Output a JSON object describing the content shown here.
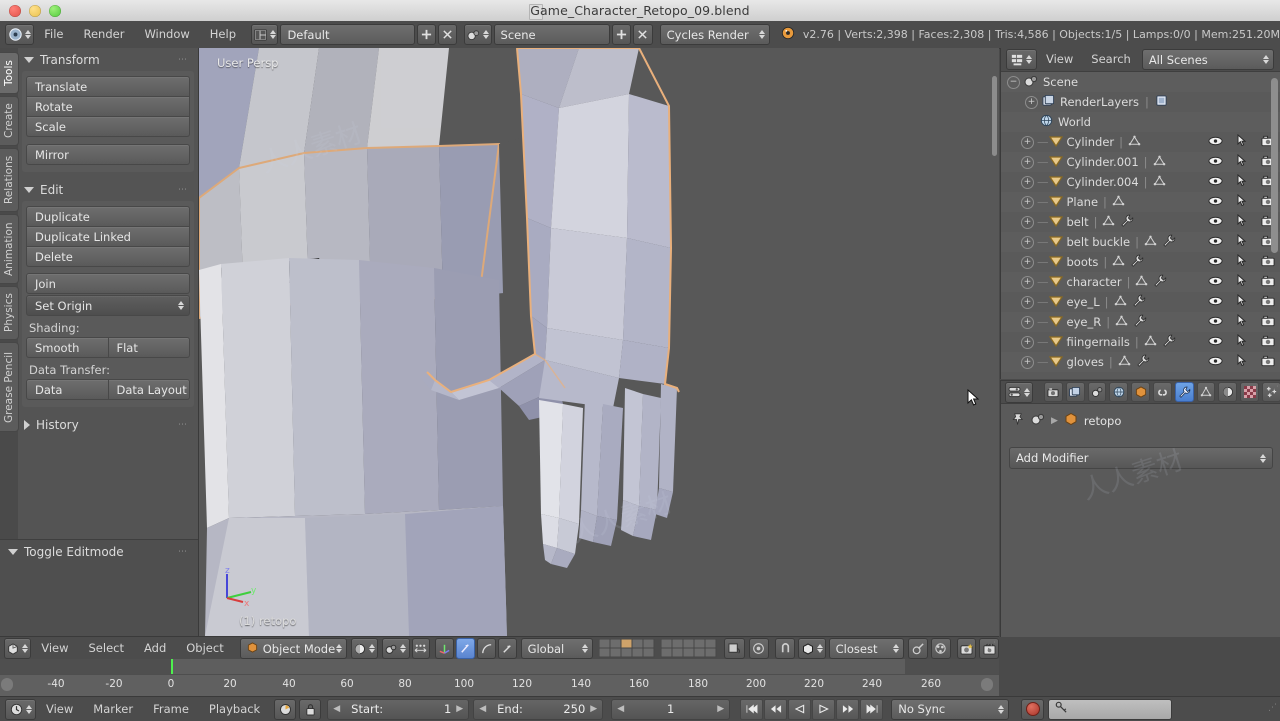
{
  "window": {
    "title": "Game_Character_Retopo_09.blend",
    "traffic_lights": [
      "close-red",
      "minimize-yellow",
      "maximize-green"
    ]
  },
  "topbar": {
    "blender_icon": "blender-logo-icon",
    "menus": [
      "File",
      "Render",
      "Window",
      "Help"
    ],
    "screen_layout_icon": "screen-layout-icon",
    "screen_layout": "Default",
    "add_layout_icon": "plus-icon",
    "delete_layout_icon": "x-cross-icon",
    "scene_icon": "scene-icon",
    "scene": "Scene",
    "add_scene_icon": "plus-icon",
    "delete_scene_icon": "x-cross-icon",
    "render_engine": "Cycles Render",
    "render_engine_icon": "render-engine-icon",
    "stats": "v2.76 | Verts:2,398 | Faces:2,308 | Tris:4,586 | Objects:1/5 | Lamps:0/0 | Mem:251.20M"
  },
  "toolshelf": {
    "tabs": [
      {
        "label": "Tools",
        "active": true
      },
      {
        "label": "Create",
        "active": false
      },
      {
        "label": "Relations",
        "active": false
      },
      {
        "label": "Animation",
        "active": false
      },
      {
        "label": "Physics",
        "active": false
      },
      {
        "label": "Grease Pencil",
        "active": false
      }
    ],
    "panels": [
      {
        "title": "Transform",
        "open": true,
        "buttons": [
          "Translate",
          "Rotate",
          "Scale",
          "Mirror"
        ]
      },
      {
        "title": "Edit",
        "open": true,
        "buttons": [
          "Duplicate",
          "Duplicate Linked",
          "Delete",
          "Join"
        ],
        "dropdown": "Set Origin",
        "shading_label": "Shading:",
        "shading": [
          "Smooth",
          "Flat"
        ],
        "data_transfer_label": "Data Transfer:",
        "data_transfer": [
          "Data",
          "Data Layout"
        ]
      },
      {
        "title": "History",
        "open": false
      }
    ],
    "bottom_panel": "Toggle Editmode"
  },
  "viewport": {
    "view_label": "User Persp",
    "object_label": "(1) retopo",
    "axis_labels": [
      "z",
      "y",
      "x"
    ],
    "axis_colors": {
      "z": "#4646d8",
      "y": "#3ecf3e",
      "x": "#d83c3c"
    },
    "background": "#585858",
    "selection_outline": "#e8b07a",
    "cursor": "mouse-pointer-icon"
  },
  "viewport_footer": {
    "editor_type_icon": "3d-view-icon",
    "menus": [
      "View",
      "Select",
      "Add",
      "Object"
    ],
    "mode_icon": "object-cube-icon",
    "mode": "Object Mode",
    "shading_icon": "solid-shading-icon",
    "pivot_icon": "pivot-median-icon",
    "manipulator_icons": [
      "translate-manipulator-icon",
      "rotate-manipulator-icon",
      "scale-manipulator-icon"
    ],
    "orientation": "Global",
    "layers_icon": "scene-layers-grid",
    "lock_icon": "lock-scene-icon",
    "proportional_icon": "proportional-edit-icon",
    "snap_magnet_icon": "snap-magnet-icon",
    "snap_element_icon": "snap-vertex-icon",
    "snap_target": "Closest",
    "opengl_render_icon": "opengl-render-icon",
    "opengl_anim_icon": "opengl-render-anim-icon"
  },
  "outliner": {
    "display_mode_icon": "outliner-display-icon",
    "menus": [
      "View",
      "Search"
    ],
    "scope": "All Scenes",
    "root": {
      "label": "Scene",
      "icon": "scene-icon",
      "expanded": true
    },
    "items": [
      {
        "label": "RenderLayers",
        "icon": "renderlayers-icon",
        "indent": 2,
        "expandable": true,
        "extra_icon": "renderlayer-data-icon",
        "rowicons": false
      },
      {
        "label": "World",
        "icon": "world-icon",
        "indent": 2,
        "expandable": false,
        "rowicons": false
      },
      {
        "label": "Cylinder",
        "icon": "mesh-object-icon",
        "indent": 1,
        "expandable": true,
        "mesh": true,
        "modifier": false,
        "rowicons": true
      },
      {
        "label": "Cylinder.001",
        "icon": "mesh-object-icon",
        "indent": 1,
        "expandable": true,
        "mesh": true,
        "modifier": false,
        "rowicons": true
      },
      {
        "label": "Cylinder.004",
        "icon": "mesh-object-icon",
        "indent": 1,
        "expandable": true,
        "mesh": true,
        "modifier": false,
        "rowicons": true
      },
      {
        "label": "Plane",
        "icon": "mesh-object-icon",
        "indent": 1,
        "expandable": true,
        "mesh": true,
        "modifier": false,
        "rowicons": true
      },
      {
        "label": "belt",
        "icon": "mesh-object-icon",
        "indent": 1,
        "expandable": true,
        "mesh": true,
        "modifier": true,
        "rowicons": true
      },
      {
        "label": "belt buckle",
        "icon": "mesh-object-icon",
        "indent": 1,
        "expandable": true,
        "mesh": true,
        "modifier": true,
        "rowicons": true
      },
      {
        "label": "boots",
        "icon": "mesh-object-icon",
        "indent": 1,
        "expandable": true,
        "mesh": true,
        "modifier": true,
        "rowicons": true
      },
      {
        "label": "character",
        "icon": "mesh-object-icon",
        "indent": 1,
        "expandable": true,
        "mesh": true,
        "modifier": true,
        "rowicons": true
      },
      {
        "label": "eye_L",
        "icon": "mesh-object-icon",
        "indent": 1,
        "expandable": true,
        "mesh": true,
        "modifier": true,
        "rowicons": true
      },
      {
        "label": "eye_R",
        "icon": "mesh-object-icon",
        "indent": 1,
        "expandable": true,
        "mesh": true,
        "modifier": true,
        "rowicons": true
      },
      {
        "label": "fiingernails",
        "icon": "mesh-object-icon",
        "indent": 1,
        "expandable": true,
        "mesh": true,
        "modifier": true,
        "rowicons": true
      },
      {
        "label": "gloves",
        "icon": "mesh-object-icon",
        "indent": 1,
        "expandable": true,
        "mesh": true,
        "modifier": true,
        "rowicons": true
      }
    ],
    "row_icons": [
      "eye-visibility-icon",
      "cursor-selectable-icon",
      "camera-renderable-icon"
    ]
  },
  "properties": {
    "editor_type_icon": "properties-editor-icon",
    "tabs": [
      {
        "name": "render-tab",
        "icon": "camera-back-icon",
        "active": false
      },
      {
        "name": "render-layers-tab",
        "icon": "render-layers-icon",
        "active": false
      },
      {
        "name": "scene-tab",
        "icon": "scene-cone-icon",
        "active": false
      },
      {
        "name": "world-tab",
        "icon": "world-globe-icon",
        "active": false
      },
      {
        "name": "object-tab",
        "icon": "object-cube-icon",
        "active": false
      },
      {
        "name": "constraints-tab",
        "icon": "chain-link-icon",
        "active": false
      },
      {
        "name": "modifiers-tab",
        "icon": "wrench-icon",
        "active": true
      },
      {
        "name": "data-tab",
        "icon": "mesh-data-icon",
        "active": false
      },
      {
        "name": "material-tab",
        "icon": "material-sphere-icon",
        "active": false
      },
      {
        "name": "texture-tab",
        "icon": "checker-texture-icon",
        "active": false
      },
      {
        "name": "particles-tab",
        "icon": "particles-icon",
        "active": false
      }
    ],
    "pin_icon": "pin-icon",
    "scene_icon": "scene-icon",
    "breadcrumb_separator": "chevron-right-icon",
    "object_icon": "object-cube-icon",
    "object_name": "retopo",
    "add_modifier": "Add Modifier"
  },
  "timeline": {
    "editor_type_icon": "timeline-editor-icon",
    "menus": [
      "View",
      "Marker",
      "Frame",
      "Playback"
    ],
    "autokey_icon": "auto-keyframe-icon",
    "lock_icon": "lock-icon",
    "start_label": "Start:",
    "start_value": "1",
    "end_label": "End:",
    "end_value": "250",
    "current_frame": "1",
    "transport": [
      "jump-start-icon",
      "prev-keyframe-icon",
      "play-reverse-icon",
      "play-icon",
      "next-keyframe-icon",
      "jump-end-icon"
    ],
    "sync_mode": "No Sync",
    "record_icon": "record-icon",
    "keying_set_icon": "keying-set-icon",
    "ruler_ticks": [
      -40,
      -20,
      0,
      20,
      40,
      60,
      80,
      100,
      120,
      140,
      160,
      180,
      200,
      220,
      240,
      260
    ],
    "playhead_frame": 1
  },
  "watermark": "人人素材"
}
